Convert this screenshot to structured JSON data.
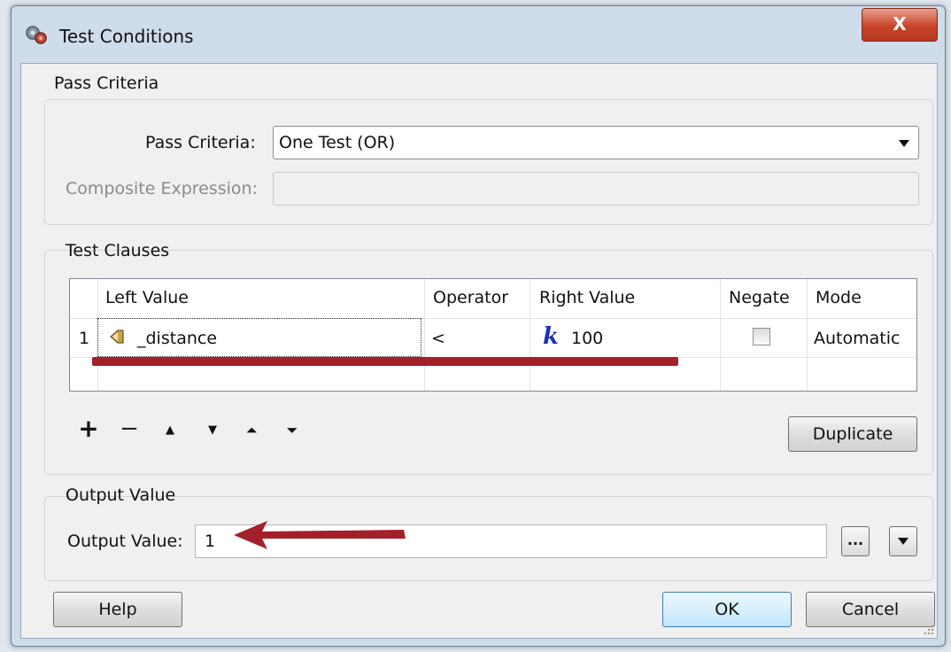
{
  "window": {
    "title": "Test Conditions",
    "close_label": "X"
  },
  "pass_criteria_group": {
    "title": "Pass Criteria",
    "pass_criteria_label": "Pass Criteria:",
    "pass_criteria_value": "One Test (OR)",
    "composite_expression_label": "Composite Expression:",
    "composite_expression_value": ""
  },
  "test_clauses_group": {
    "title": "Test Clauses",
    "columns": [
      "Left Value",
      "Operator",
      "Right Value",
      "Negate",
      "Mode"
    ],
    "rows": [
      {
        "number": "1",
        "left_value": "_distance",
        "operator": "<",
        "right_value": "100",
        "negate": false,
        "mode": "Automatic"
      }
    ],
    "toolbar": {
      "add": "+",
      "remove": "−",
      "move_up": "▲",
      "move_down": "▼",
      "move_top": "⏶",
      "move_bottom": "⏷"
    },
    "duplicate_label": "Duplicate"
  },
  "output_value_group": {
    "title": "Output Value",
    "label": "Output Value:",
    "value": "1",
    "ellipsis_label": "..."
  },
  "buttons": {
    "help": "Help",
    "ok": "OK",
    "cancel": "Cancel"
  },
  "colors": {
    "annotation_red": "#a3202a",
    "title_bar": "#cfdcea",
    "close_button": "#c8442a"
  }
}
